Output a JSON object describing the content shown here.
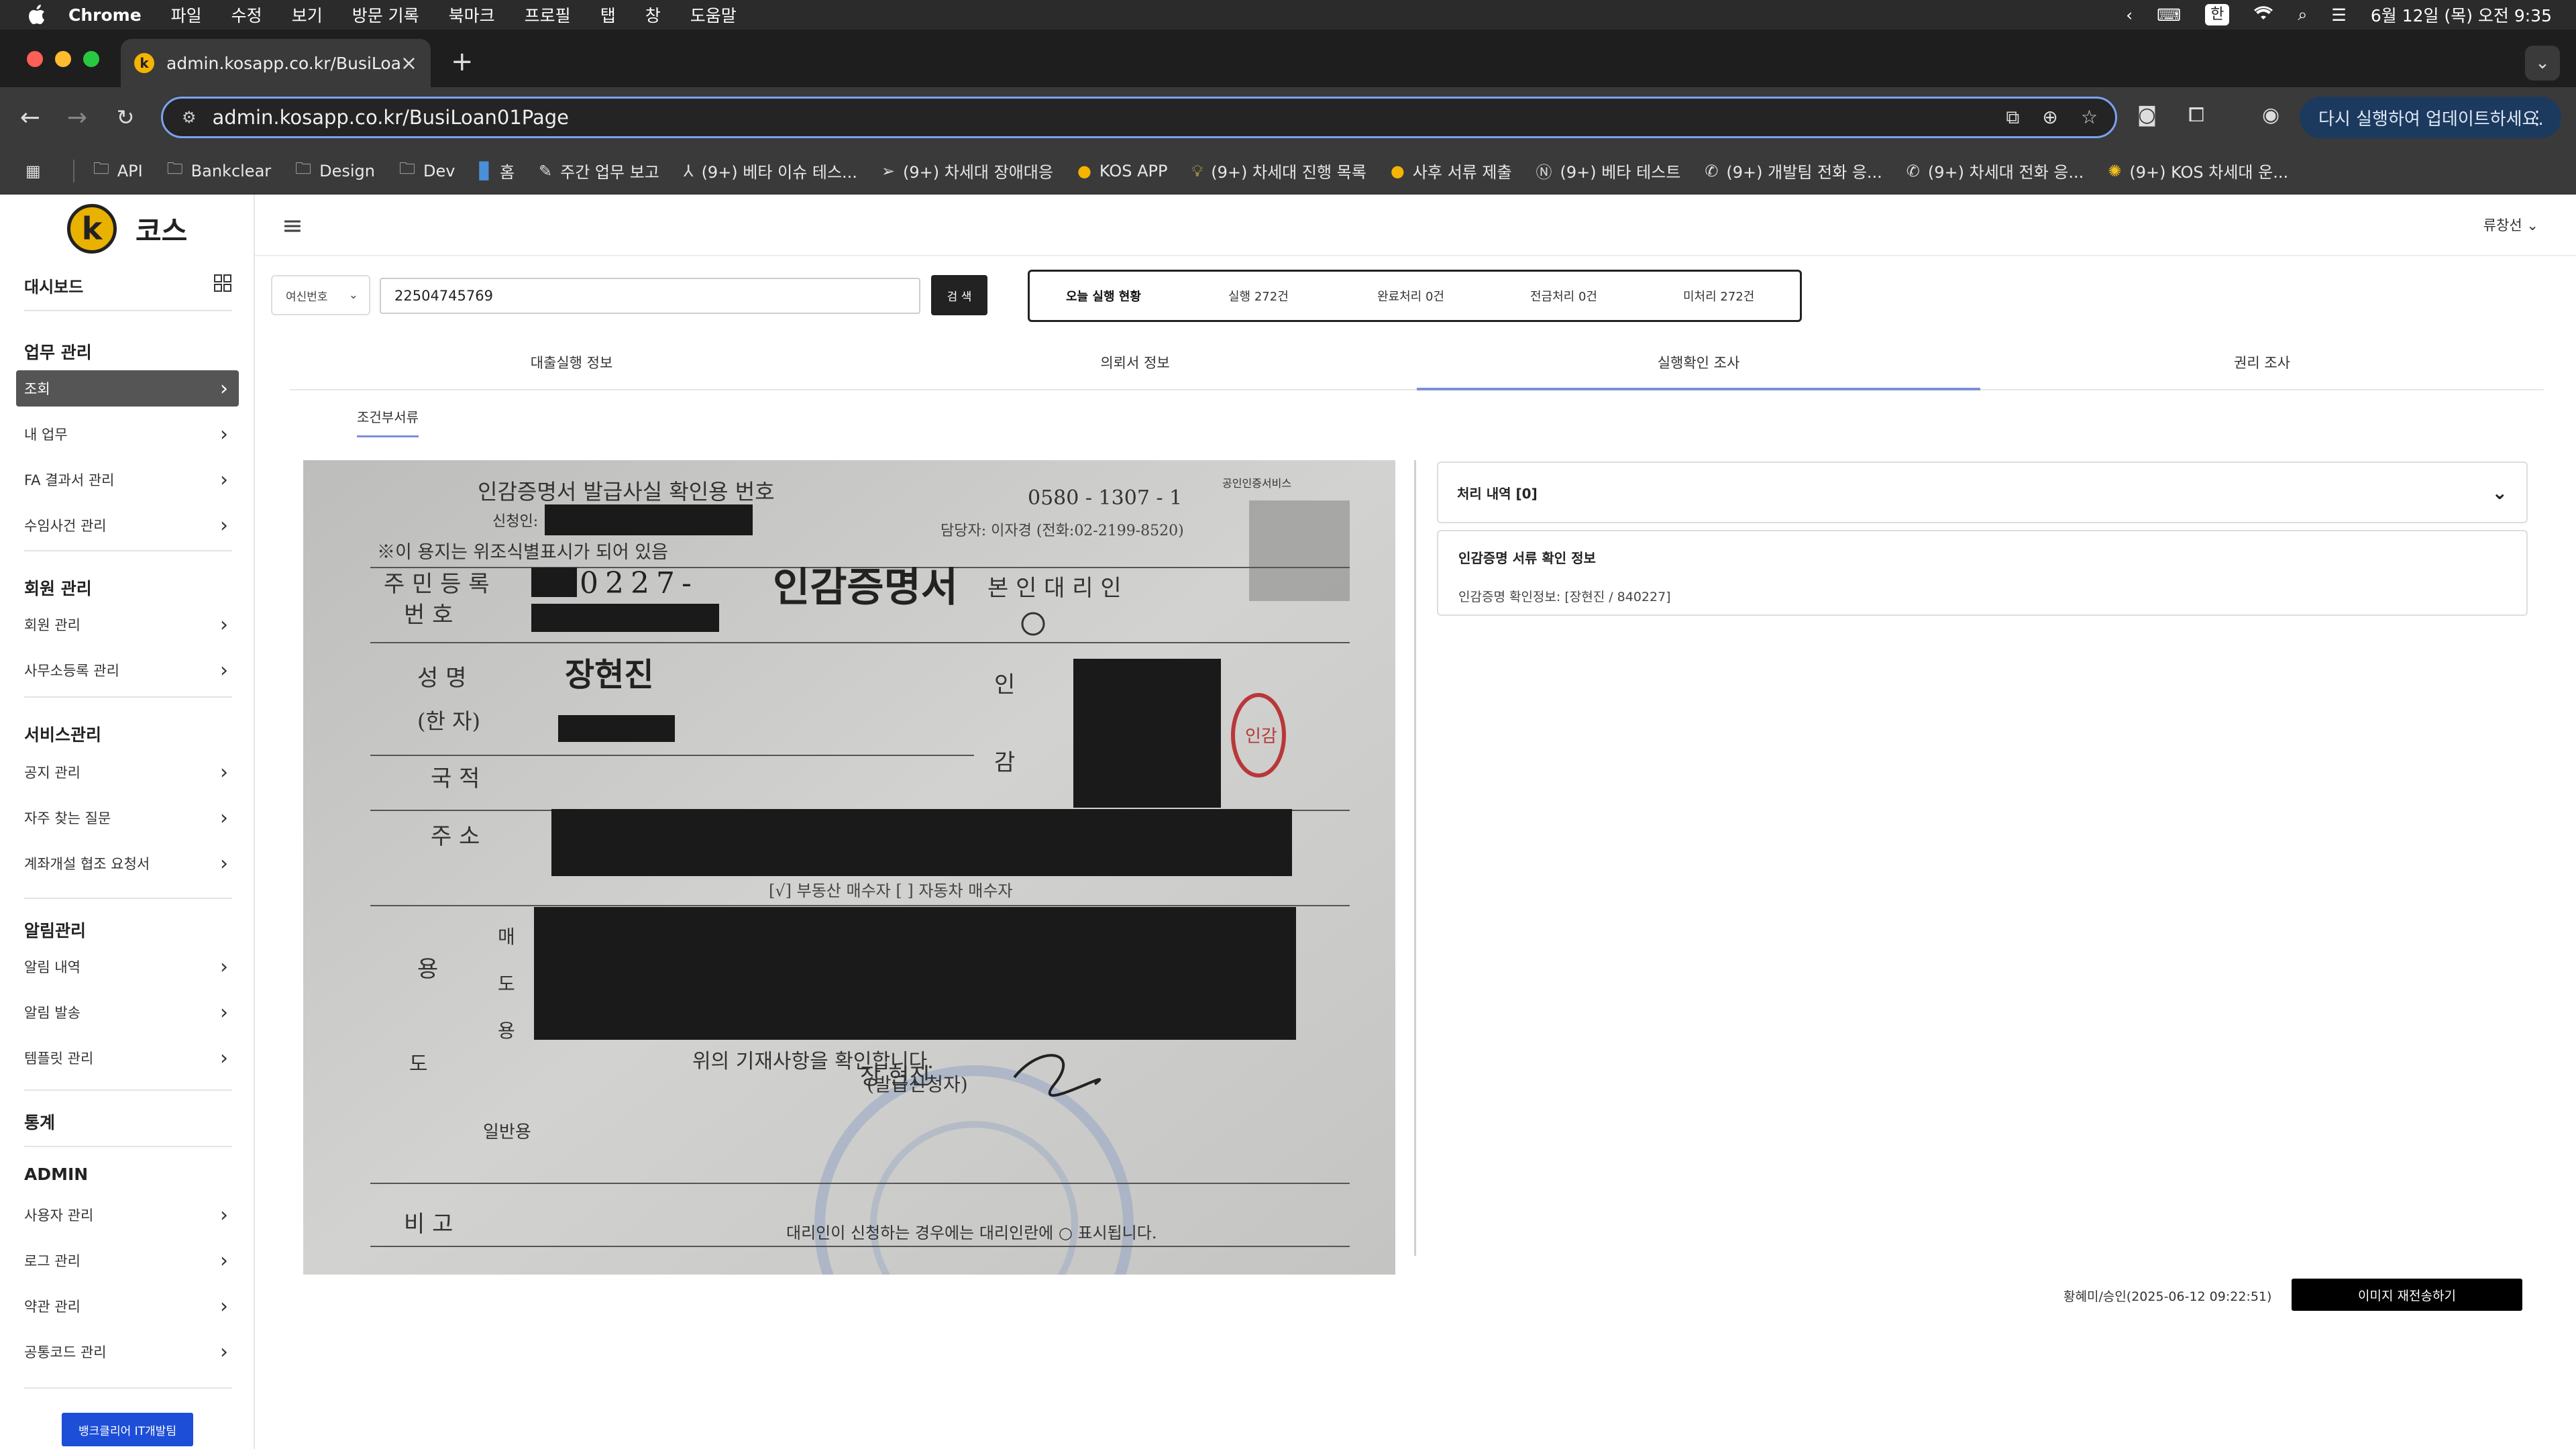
{
  "menubar": {
    "app": "Chrome",
    "items": [
      "파일",
      "수정",
      "보기",
      "방문 기록",
      "북마크",
      "프로필",
      "탭",
      "창",
      "도움말"
    ],
    "ime": "한",
    "datetime": "6월 12일 (목) 오전 9:35"
  },
  "browser": {
    "tab_title": "admin.kosapp.co.kr/BusiLoan",
    "url": "admin.kosapp.co.kr/BusiLoan01Page",
    "update_label": "다시 실행하여 업데이트하세요."
  },
  "bookmarks": [
    {
      "icon": "folder-icon",
      "label": "API"
    },
    {
      "icon": "folder-icon",
      "label": "Bankclear"
    },
    {
      "icon": "folder-icon",
      "label": "Design"
    },
    {
      "icon": "folder-icon",
      "label": "Dev"
    },
    {
      "icon": "page-icon",
      "label": "홈"
    },
    {
      "icon": "page-icon",
      "label": "주간 업무 보고"
    },
    {
      "icon": "page-icon",
      "label": "(9+) 베타 이슈 테스..."
    },
    {
      "icon": "page-icon",
      "label": "(9+) 차세대 장애대응"
    },
    {
      "icon": "kos-icon",
      "label": "KOS APP"
    },
    {
      "icon": "bulb-icon",
      "label": "(9+) 차세대 진행 목록"
    },
    {
      "icon": "kos-icon",
      "label": "사후 서류 제출"
    },
    {
      "icon": "notion-icon",
      "label": "(9+) 베타 테스트"
    },
    {
      "icon": "phone-icon",
      "label": "(9+) 개발팀 전화 응..."
    },
    {
      "icon": "phone-icon",
      "label": "(9+) 차세대 전화 응..."
    },
    {
      "icon": "sun-icon",
      "label": "(9+) KOS 차세대 운..."
    }
  ],
  "sidebar": {
    "logo_text": "코스",
    "logo_mark": "k",
    "dashboard": "대시보드",
    "sections": [
      {
        "title": "업무 관리",
        "items": [
          "조회",
          "내 업무",
          "FA 결과서 관리",
          "수임사건 관리"
        ]
      },
      {
        "title": "회원 관리",
        "items": [
          "회원 관리",
          "사무소등록 관리"
        ]
      },
      {
        "title": "서비스관리",
        "items": [
          "공지 관리",
          "자주 찾는 질문",
          "계좌개설 협조 요청서"
        ]
      },
      {
        "title": "알림관리",
        "items": [
          "알림 내역",
          "알림 발송",
          "템플릿 관리"
        ]
      },
      {
        "title": "통계",
        "items": []
      },
      {
        "title": "ADMIN",
        "items": [
          "사용자 관리",
          "로그 관리",
          "약관 관리",
          "공통코드 관리"
        ]
      }
    ],
    "active_item": "조회",
    "bottom_button": "뱅크클리어 IT개발팀"
  },
  "header": {
    "user": "류창선"
  },
  "search": {
    "select_value": "여신번호",
    "input_value": "22504745769",
    "button": "검 색"
  },
  "status": {
    "title": "오늘 실행 현황",
    "executed": "실행 272건",
    "done": "완료처리 0건",
    "transfer": "전금처리 0건",
    "unprocessed": "미처리 272건"
  },
  "tabs": [
    "대출실행 정보",
    "의뢰서 정보",
    "실행확인 조사",
    "권리 조사"
  ],
  "active_tab": 2,
  "subtab": "조건부서류",
  "document": {
    "header_line": "인감증명서 발급사실 확인용 번호",
    "doc_no": "0580 - 1307 - 1",
    "applicant_label": "신청인:",
    "contact": "담당자: 이자경 (전화:02-2199-8520)",
    "notice": "※이 용지는 위조식별표시가 되어 있음",
    "reg_label": "주 민 등 록",
    "reg_label2": "번 호",
    "reg_partial": "0227-",
    "title": "인감증명서",
    "self_agent": "본 인   대 리 인",
    "name_label": "성 명",
    "name_value": "장현진",
    "hanja_label": "(한 자)",
    "seal_label": "인",
    "seal_label2": "감",
    "nation_label": "국 적",
    "address_label": "주 소",
    "checks": "[√] 부동산 매수자   [ ] 자동차 매수자",
    "use_label": "용",
    "sell_label": "매",
    "do_label": "도",
    "yong_label": "용",
    "general_label": "일반용",
    "do2_label": "도",
    "confirm_text": "위의 기재사항을 확인합니다.",
    "issuer_label": "(발급신청자)",
    "issuer_sign": "장 현진",
    "remarks_label": "비 고",
    "footer_text": "대리인이 신청하는 경우에는 대리인란에 ○ 표시됩니다.",
    "stamp_text": "인감",
    "corner_stamp": "공인인증서비스"
  },
  "panel": {
    "accordion_title": "처리 내역 [0]",
    "card_title": "인감증명 서류 확인 정보",
    "card_line": "인감증명 확인정보: [장현진 / 840227]"
  },
  "footer": {
    "approval": "황혜미/승인(2025-06-12 09:22:51)",
    "resend_button": "이미지 재전송하기"
  }
}
